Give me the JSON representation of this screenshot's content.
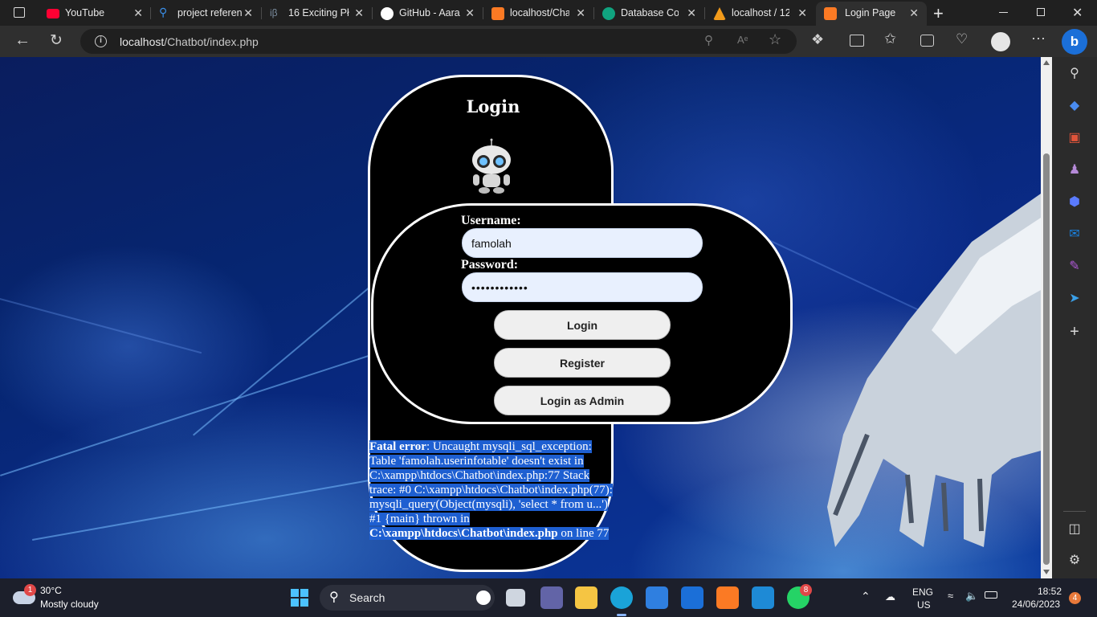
{
  "browser": {
    "tabs": [
      {
        "title": "YouTube",
        "icon": "youtube-icon",
        "color": "#ff0033"
      },
      {
        "title": "project referen",
        "icon": "search-icon",
        "color": "#3a8ee6"
      },
      {
        "title": "16 Exciting Pł",
        "icon": "ib-icon",
        "color": "#6b7d8f"
      },
      {
        "title": "GitHub - Aara",
        "icon": "github-icon",
        "color": "#ffffff"
      },
      {
        "title": "localhost/Cha",
        "icon": "xampp-icon",
        "color": "#fb7a24"
      },
      {
        "title": "Database Cor",
        "icon": "openai-icon",
        "color": "#10a37f"
      },
      {
        "title": "localhost / 12",
        "icon": "phpmyadmin-icon",
        "color": "#f29b1b"
      },
      {
        "title": "Login Page",
        "icon": "xampp-icon",
        "color": "#fb7a24"
      }
    ],
    "url_host": "localhost",
    "url_path": "/Chatbot/index.php"
  },
  "login": {
    "title": "Login",
    "username_label": "Username:",
    "username_value": "famolah",
    "password_label": "Password:",
    "password_value": "••••••••••••",
    "login_button": "Login",
    "register_button": "Register",
    "admin_button": "Login as Admin"
  },
  "error": {
    "label": "Fatal error",
    "message": ": Uncaught mysqli_sql_exception: Table 'famolah.userinfotable' doesn't exist in C:\\xampp\\htdocs\\Chatbot\\index.php:77 Stack trace: #0 C:\\xampp\\htdocs\\Chatbot\\index.php(77): mysqli_query(Object(mysqli), 'select * from u...') #1 {main} thrown in ",
    "file": "C:\\xampp\\htdocs\\Chatbot\\index.php",
    "suffix": " on line 77"
  },
  "taskbar": {
    "weather_temp": "30°C",
    "weather_desc": "Mostly cloudy",
    "weather_badge": "1",
    "search_label": "Search",
    "lang": "ENG",
    "region": "US",
    "time": "18:52",
    "date": "24/06/2023",
    "notif_count": "4",
    "whatsapp_badge": "8"
  }
}
